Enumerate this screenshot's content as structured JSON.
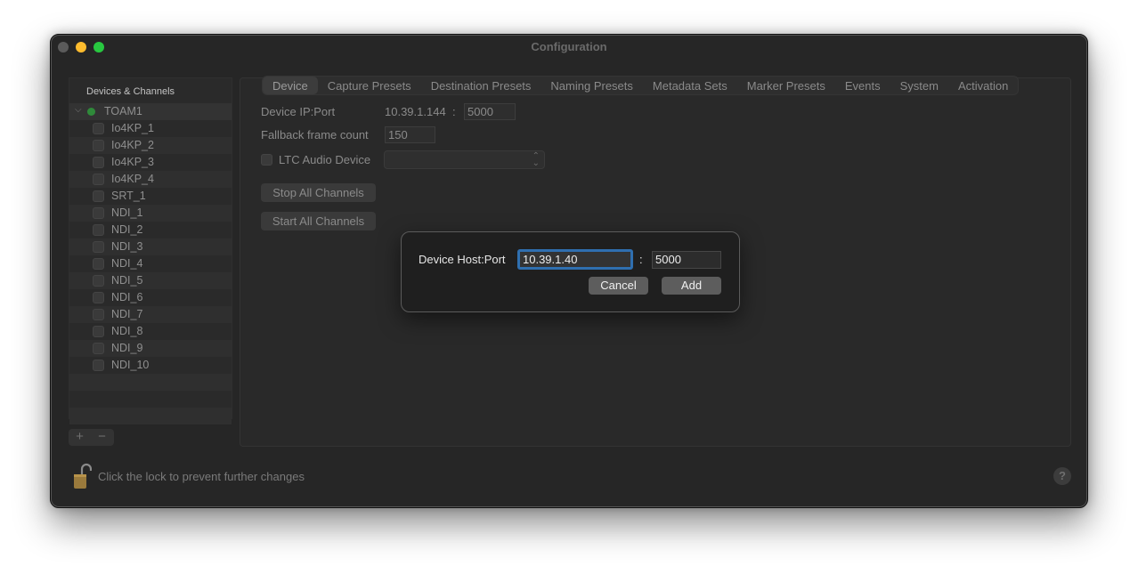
{
  "window": {
    "title": "Configuration"
  },
  "sidebar": {
    "header": "Devices & Channels",
    "root": {
      "label": "TOAM1",
      "status_color": "#2f8a3a",
      "expanded": true
    },
    "channels": [
      "Io4KP_1",
      "Io4KP_2",
      "Io4KP_3",
      "Io4KP_4",
      "SRT_1",
      "NDI_1",
      "NDI_2",
      "NDI_3",
      "NDI_4",
      "NDI_5",
      "NDI_6",
      "NDI_7",
      "NDI_8",
      "NDI_9",
      "NDI_10"
    ],
    "add_label": "+",
    "remove_label": "−"
  },
  "tabs": [
    "Device",
    "Capture Presets",
    "Destination Presets",
    "Naming Presets",
    "Metadata Sets",
    "Marker Presets",
    "Events",
    "System",
    "Activation"
  ],
  "active_tab": "Device",
  "device": {
    "ip_port_label": "Device IP:Port",
    "ip_value": "10.39.1.144",
    "ip_colon": ":",
    "port_value": "5000",
    "fallback_label": "Fallback frame count",
    "fallback_value": "150",
    "ltc_label": "LTC Audio Device",
    "ltc_value": "",
    "stop_all": "Stop All Channels",
    "start_all": "Start All Channels"
  },
  "footer": {
    "lock_text": "Click the lock to prevent further changes",
    "help": "?"
  },
  "dialog": {
    "label": "Device Host:Port",
    "host_value": "10.39.1.40",
    "colon": ":",
    "port_value": "5000",
    "cancel": "Cancel",
    "add": "Add"
  },
  "colors": {
    "accent_focus": "#2f6fb0",
    "close": "#5b5b5b",
    "minimize": "#febc2e",
    "maximize": "#28c840"
  }
}
